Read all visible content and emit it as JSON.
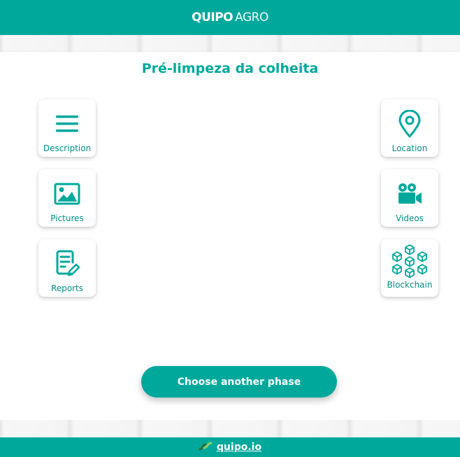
{
  "header": {
    "logo_bold": "QUIPO",
    "logo_light": "AGRO"
  },
  "page": {
    "title": "Pré-limpeza da colheita"
  },
  "tiles": {
    "description": {
      "label": "Description",
      "icon": "hamburger-lines-icon"
    },
    "pictures": {
      "label": "Pictures",
      "icon": "image-icon"
    },
    "reports": {
      "label": "Reports",
      "icon": "document-pencil-icon"
    },
    "location": {
      "label": "Location",
      "icon": "map-pin-icon"
    },
    "videos": {
      "label": "Videos",
      "icon": "video-camera-icon"
    },
    "blockchain": {
      "label": "Blockchain",
      "icon": "blockchain-cubes-icon"
    }
  },
  "cta": {
    "label": "Choose another phase"
  },
  "footer": {
    "link_label": "quipo.io",
    "icon": "quipo-link-icon"
  },
  "colors": {
    "brand": "#00a89c",
    "label": "#008f86",
    "background": "#ffffff"
  }
}
